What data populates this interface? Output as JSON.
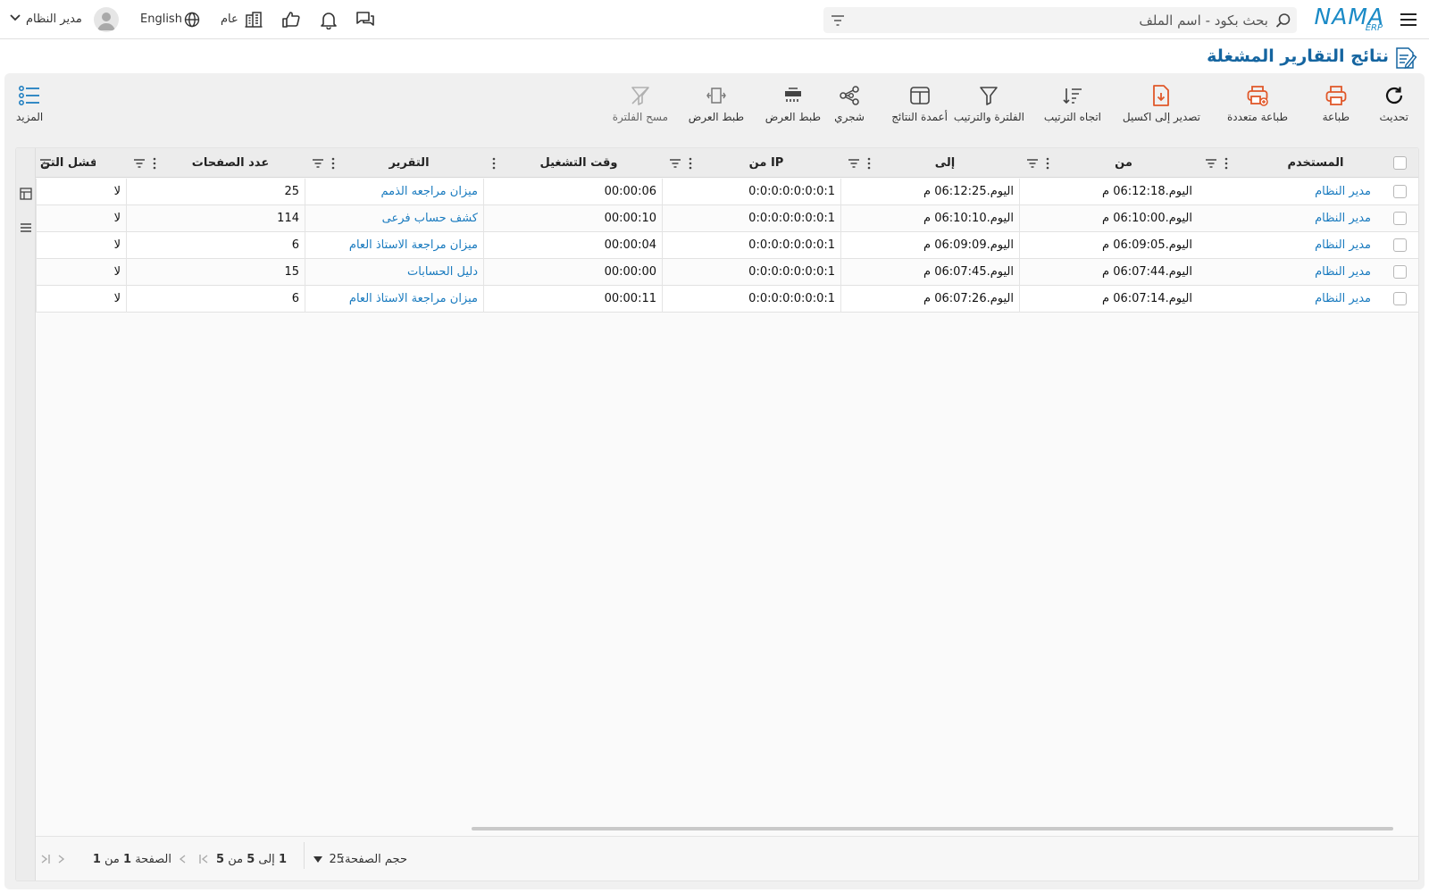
{
  "header": {
    "logo_text": "NAMA",
    "logo_sub": "ERP",
    "search_placeholder": "بحث بكود - اسم الملف",
    "company_label": "عام",
    "language_label": "English",
    "user_name": "مدير النظام"
  },
  "page": {
    "title": "نتائج التقارير المشغلة"
  },
  "toolbar": {
    "refresh": "تحديث",
    "print": "طباعة",
    "multi_print": "طباعة متعددة",
    "export_excel": "تصدير إلى اكسيل",
    "sort_direction": "اتجاه الترتيب",
    "filter_sort": "الفلترة والترتيب",
    "result_columns": "أعمدة النتائج",
    "tree": "شجري",
    "fit_view_1": "طبط العرض",
    "fit_view_2": "طبط العرض",
    "clear_filter": "مسح الفلترة",
    "more": "المزيد"
  },
  "colors": {
    "accent": "#1a7bbf",
    "orange": "#e0582a",
    "title": "#1565a0"
  },
  "table": {
    "columns": [
      "المستخدم",
      "من",
      "إلى",
      "من IP",
      "وقت التشغيل",
      "التقرير",
      "عدد الصفحات",
      "فشل التن"
    ],
    "rows": [
      [
        "مدير النظام",
        "اليوم.06:12:18 م",
        "اليوم.06:12:25 م",
        "0:0:0:0:0:0:0:1",
        "00:00:06",
        "ميزان مراجعه الذمم",
        "25",
        "لا"
      ],
      [
        "مدير النظام",
        "اليوم.06:10:00 م",
        "اليوم.06:10:10 م",
        "0:0:0:0:0:0:0:1",
        "00:00:10",
        "كشف حساب فرعى",
        "114",
        "لا"
      ],
      [
        "مدير النظام",
        "اليوم.06:09:05 م",
        "اليوم.06:09:09 م",
        "0:0:0:0:0:0:0:1",
        "00:00:04",
        "ميزان مراجعة الاستاذ العام",
        "6",
        "لا"
      ],
      [
        "مدير النظام",
        "اليوم.06:07:44 م",
        "اليوم.06:07:45 م",
        "0:0:0:0:0:0:0:1",
        "00:00:00",
        "دليل الحسابات",
        "15",
        "لا"
      ],
      [
        "مدير النظام",
        "اليوم.06:07:14 م",
        "اليوم.06:07:26 م",
        "0:0:0:0:0:0:0:1",
        "00:00:11",
        "ميزان مراجعة الاستاذ العام",
        "6",
        "لا"
      ]
    ]
  },
  "footer": {
    "page_size_label": "حجم الصفحة:",
    "page_size_value": "25",
    "range_from": "1",
    "range_to_label": "إلى",
    "range_to": "5",
    "range_of_label": "من",
    "range_total": "5",
    "page_label": "الصفحة",
    "page_current": "1",
    "page_of_label": "من",
    "page_total": "1"
  }
}
